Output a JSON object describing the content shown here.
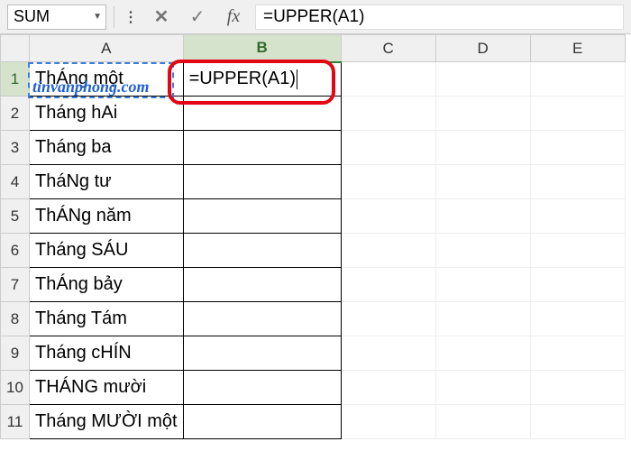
{
  "name_box": "SUM",
  "formula_bar": "=UPPER(A1)",
  "watermark": "tinvanphong.com",
  "columns": [
    "A",
    "B",
    "C",
    "D",
    "E"
  ],
  "active_col_index": 1,
  "active_row_index": 0,
  "cell_b1_editing": "=UPPER(A1)",
  "col_a": [
    "ThÁng một",
    "Tháng hAi",
    "Tháng ba",
    "TháNg tư",
    "ThÁNg năm",
    "Tháng SÁU",
    "ThÁng bảy",
    "Tháng Tám",
    "Tháng cHÍN",
    "THÁNG mười",
    "Tháng MƯỜI một"
  ],
  "colors": {
    "highlight": "#e30613",
    "active_green": "#2e7d32",
    "ref_blue": "#3b7ddd",
    "link_blue": "#1e5fd6"
  }
}
